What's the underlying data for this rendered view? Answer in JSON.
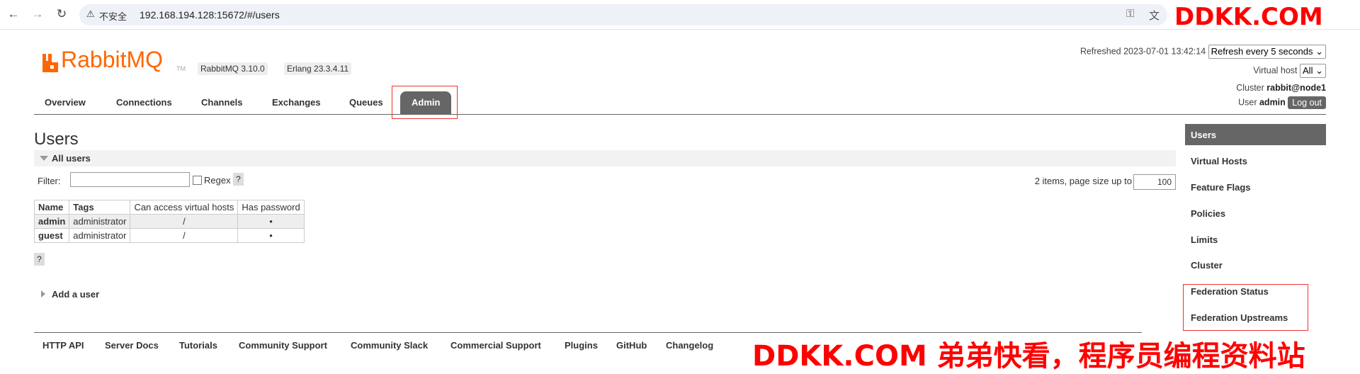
{
  "browser": {
    "security_label": "不安全",
    "url": "192.168.194.128:15672/#/users"
  },
  "watermark": {
    "top": "DDKK.COM",
    "bottom": "DDKK.COM 弟弟快看，程序员编程资料站",
    "color": "#ff0000"
  },
  "brand": {
    "logo_text": "RabbitMQ",
    "tm": "TM",
    "version": "RabbitMQ 3.10.0",
    "erlang": "Erlang 23.3.4.11",
    "accent": "#ff6600"
  },
  "header": {
    "refreshed_label": "Refreshed",
    "refreshed_time": "2023-07-01 13:42:14",
    "refresh_option": "Refresh every 5 seconds",
    "vhost_label": "Virtual host",
    "vhost_value": "All",
    "cluster_label": "Cluster",
    "cluster_value": "rabbit@node1",
    "user_label": "User",
    "user_value": "admin",
    "logout": "Log out"
  },
  "tabs": [
    "Overview",
    "Connections",
    "Channels",
    "Exchanges",
    "Queues",
    "Admin"
  ],
  "active_tab": "Admin",
  "page": {
    "title": "Users",
    "section": "All users",
    "filter_label": "Filter:",
    "filter_value": "",
    "regex_label": "Regex",
    "help": "?",
    "items_info": "2 items, page size up to",
    "page_size": "100",
    "add_user": "Add a user"
  },
  "table": {
    "columns": [
      "Name",
      "Tags",
      "Can access virtual hosts",
      "Has password"
    ],
    "rows": [
      [
        "admin",
        "administrator",
        "/",
        "•"
      ],
      [
        "guest",
        "administrator",
        "/",
        "•"
      ]
    ]
  },
  "sidebar": [
    "Users",
    "Virtual Hosts",
    "Feature Flags",
    "Policies",
    "Limits",
    "Cluster",
    "Federation Status",
    "Federation Upstreams"
  ],
  "footer": [
    "HTTP API",
    "Server Docs",
    "Tutorials",
    "Community Support",
    "Community Slack",
    "Commercial Support",
    "Plugins",
    "GitHub",
    "Changelog"
  ]
}
